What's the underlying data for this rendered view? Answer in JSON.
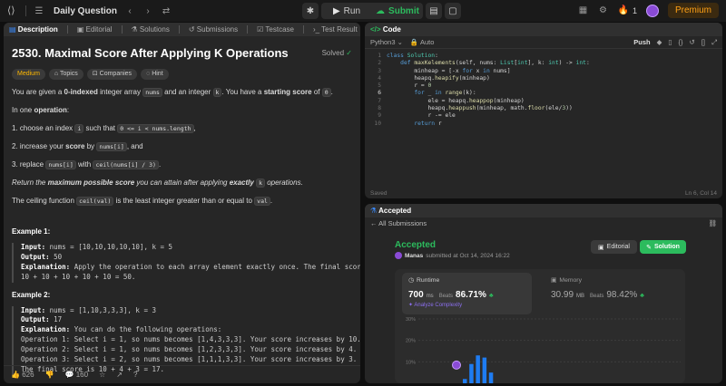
{
  "topbar": {
    "title": "Daily Question",
    "run_label": "Run",
    "submit_label": "Submit",
    "streak": "1",
    "premium_label": "Premium"
  },
  "left_tabs": [
    "Description",
    "Editorial",
    "Solutions",
    "Submissions",
    "Testcase",
    "Test Result"
  ],
  "problem": {
    "title": "2530. Maximal Score After Applying K Operations",
    "status": "Solved",
    "difficulty": "Medium",
    "tags": [
      "Topics",
      "Companies",
      "Hint"
    ],
    "intro_1": "You are given a ",
    "intro_b1": "0-indexed",
    "intro_2": " integer array ",
    "intro_c1": "nums",
    "intro_3": " and an integer ",
    "intro_c2": "k",
    "intro_4": ". You have a ",
    "intro_b2": "starting score",
    "intro_5": " of ",
    "intro_c3": "0",
    "intro_6": ".",
    "op_intro_1": "In one ",
    "op_intro_b": "operation",
    "op_intro_2": ":",
    "step1_a": "1. choose an index ",
    "step1_c1": "i",
    "step1_b": " such that ",
    "step1_c2": "0 <= i < nums.length",
    "step1_d": ",",
    "step2_a": "2. increase your ",
    "step2_b": "score",
    "step2_c": " by ",
    "step2_code": "nums[i]",
    "step2_d": ", and",
    "step3_a": "3. replace ",
    "step3_c1": "nums[i]",
    "step3_b": " with ",
    "step3_c2": "ceil(nums[i] / 3)",
    "step3_d": ".",
    "ret_1": "Return the ",
    "ret_b1": "maximum possible score",
    "ret_2": " you can attain after applying ",
    "ret_b2": "exactly",
    "ret_3": " ",
    "ret_c": "k",
    "ret_4": " operations.",
    "ceil_1": "The ceiling function ",
    "ceil_c1": "ceil(val)",
    "ceil_2": " is the least integer greater than or equal to ",
    "ceil_c2": "val",
    "ceil_3": ".",
    "ex1_title": "Example 1:",
    "ex1_input_label": "Input:",
    "ex1_input": " nums = [10,10,10,10,10], k = 5",
    "ex1_output_label": "Output:",
    "ex1_output": " 50",
    "ex1_expl_label": "Explanation:",
    "ex1_expl_1": " Apply the operation to each array element exactly once. The final score is",
    "ex1_expl_2": "10 + 10 + 10 + 10 + 10 = 50.",
    "ex2_title": "Example 2:",
    "ex2_input_label": "Input:",
    "ex2_input": " nums = [1,10,3,3,3], k = 3",
    "ex2_output_label": "Output:",
    "ex2_output": " 17",
    "ex2_expl_label": "Explanation:",
    "ex2_expl_1": " You can do the following operations:",
    "ex2_l1": "Operation 1: Select i = 1, so nums becomes [1,4,3,3,3]. Your score increases by 10.",
    "ex2_l2": "Operation 2: Select i = 1, so nums becomes [1,2,3,3,3]. Your score increases by 4.",
    "ex2_l3": "Operation 3: Select i = 2, so nums becomes [1,1,1,3,3]. Your score increases by 3.",
    "ex2_l4": "The final score is 10 + 4 + 3 = 17."
  },
  "footer": {
    "likes": "626",
    "comments": "160"
  },
  "code_panel": {
    "title": "Code",
    "language": "Python3",
    "mode": "Auto",
    "push_label": "Push",
    "status_left": "Saved",
    "status_right": "Ln 6, Col 14",
    "line_numbers": [
      "1",
      "2",
      "3",
      "4",
      "5",
      "6",
      "7",
      "8",
      "9",
      "10"
    ]
  },
  "result_panel": {
    "tab_label": "Accepted",
    "back_label": "All Submissions",
    "status": "Accepted",
    "user": "Manas",
    "submitted": "submitted at Oct 14, 2024 16:22",
    "editorial_label": "Editorial",
    "solution_label": "Solution",
    "runtime_label": "Runtime",
    "runtime_value": "700",
    "runtime_unit": "ms",
    "runtime_beats_label": "Beats",
    "runtime_beats": "86.71%",
    "analyze_label": "Analyze Complexity",
    "memory_label": "Memory",
    "memory_value": "30.99",
    "memory_unit": "MB",
    "memory_beats_label": "Beats",
    "memory_beats": "98.42%"
  },
  "chart_data": {
    "type": "bar",
    "y_ticks": [
      "30%",
      "20%",
      "10%"
    ],
    "ylim": [
      0,
      30
    ],
    "values": [
      2,
      9,
      13,
      12,
      5
    ],
    "grid": true
  },
  "colors": {
    "accent_green": "#2cbb5d",
    "accent_orange": "#ffa116",
    "bar_blue": "#1e7cf2"
  }
}
